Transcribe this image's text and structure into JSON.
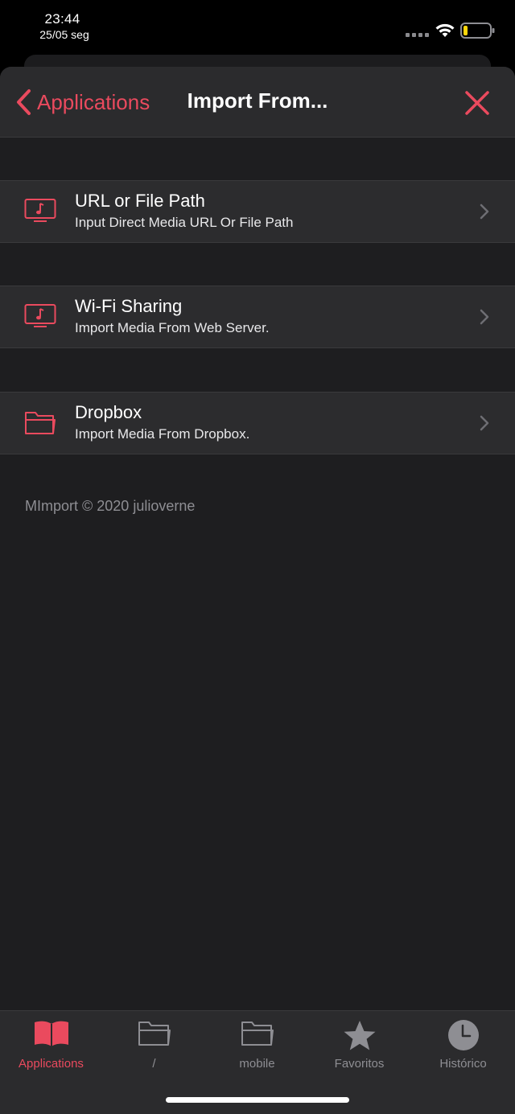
{
  "status": {
    "time": "23:44",
    "date": "25/05 seg"
  },
  "navbar": {
    "back_label": "Applications",
    "title": "Import From..."
  },
  "rows": [
    {
      "title": "URL or File Path",
      "subtitle": "Input Direct Media URL Or File Path",
      "icon": "music-screen-icon"
    },
    {
      "title": "Wi-Fi Sharing",
      "subtitle": "Import Media From Web Server.",
      "icon": "music-screen-icon"
    },
    {
      "title": "Dropbox",
      "subtitle": "Import Media From Dropbox.",
      "icon": "folder-icon"
    }
  ],
  "footer": "MImport © 2020 julioverne",
  "tabs": [
    {
      "label": "Applications",
      "icon": "book-icon",
      "active": true
    },
    {
      "label": "/",
      "icon": "folder-icon",
      "active": false
    },
    {
      "label": "mobile",
      "icon": "folder-icon",
      "active": false
    },
    {
      "label": "Favoritos",
      "icon": "star-icon",
      "active": false
    },
    {
      "label": "Histórico",
      "icon": "clock-icon",
      "active": false
    }
  ],
  "colors": {
    "accent": "#ea4a5e",
    "background": "#1e1e20",
    "row_background": "#2c2c2e",
    "inactive": "#8e8e93"
  }
}
